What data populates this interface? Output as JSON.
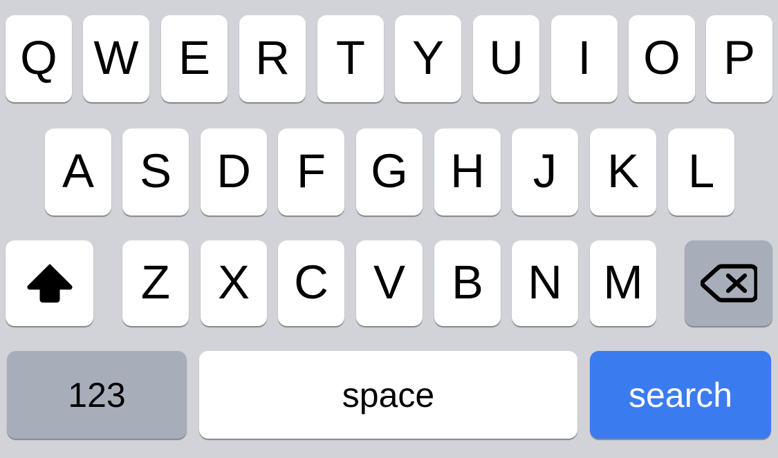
{
  "keyboard": {
    "type": "ios-software-keyboard",
    "layout": "QWERTY",
    "case": "uppercase",
    "background_color": "#d1d3d9",
    "key_color": "#ffffff",
    "special_key_color": "#a8aeb9",
    "accent_color": "#3b7bf0",
    "text_color": "#000000",
    "rows": [
      {
        "name": "row-1",
        "keys": [
          {
            "label": "Q",
            "name": "key-q"
          },
          {
            "label": "W",
            "name": "key-w"
          },
          {
            "label": "E",
            "name": "key-e"
          },
          {
            "label": "R",
            "name": "key-r"
          },
          {
            "label": "T",
            "name": "key-t"
          },
          {
            "label": "Y",
            "name": "key-y"
          },
          {
            "label": "U",
            "name": "key-u"
          },
          {
            "label": "I",
            "name": "key-i"
          },
          {
            "label": "O",
            "name": "key-o"
          },
          {
            "label": "P",
            "name": "key-p"
          }
        ]
      },
      {
        "name": "row-2",
        "keys": [
          {
            "label": "A",
            "name": "key-a"
          },
          {
            "label": "S",
            "name": "key-s"
          },
          {
            "label": "D",
            "name": "key-d"
          },
          {
            "label": "F",
            "name": "key-f"
          },
          {
            "label": "G",
            "name": "key-g"
          },
          {
            "label": "H",
            "name": "key-h"
          },
          {
            "label": "J",
            "name": "key-j"
          },
          {
            "label": "K",
            "name": "key-k"
          },
          {
            "label": "L",
            "name": "key-l"
          }
        ]
      },
      {
        "name": "row-3",
        "keys": [
          {
            "label": "Z",
            "name": "key-z"
          },
          {
            "label": "X",
            "name": "key-x"
          },
          {
            "label": "C",
            "name": "key-c"
          },
          {
            "label": "V",
            "name": "key-v"
          },
          {
            "label": "B",
            "name": "key-b"
          },
          {
            "label": "N",
            "name": "key-n"
          },
          {
            "label": "M",
            "name": "key-m"
          }
        ]
      }
    ],
    "shift": {
      "icon": "shift-arrow-up-icon",
      "label": "",
      "state": "active-uppercase"
    },
    "backspace": {
      "icon": "backspace-delete-icon",
      "label": ""
    },
    "bottom_row": {
      "numeric_key_label": "123",
      "space_key_label": "space",
      "return_key_label": "search"
    }
  }
}
